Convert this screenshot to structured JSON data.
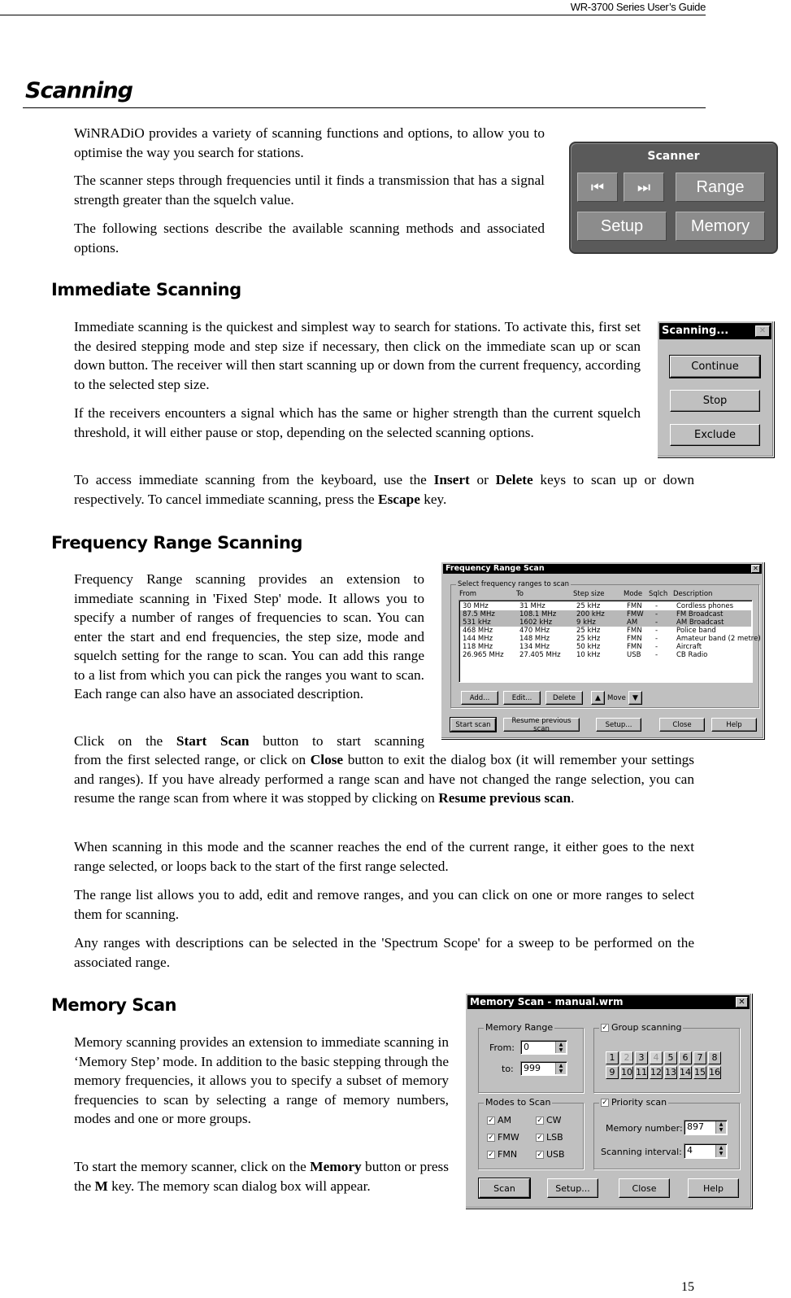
{
  "running_header": "WR-3700 Series User’s Guide",
  "page_title": "Scanning",
  "page_number": "15",
  "intro": [
    "WiNRADiO provides a variety of scanning functions and options, to allow you to optimise the way you search for stations.",
    "The scanner steps through frequencies until it finds a transmission that has a signal strength greater than the squelch value.",
    "The following sections describe the available scanning methods and associated options."
  ],
  "scanner_panel": {
    "title": "Scanner",
    "prev_icon": "skip-back-icon",
    "next_icon": "skip-forward-icon",
    "buttons": {
      "range": "Range",
      "setup": "Setup",
      "memory": "Memory"
    },
    "glyph_prev": "⏮",
    "glyph_next": "⏭"
  },
  "immediate": {
    "heading": "Immediate Scanning",
    "p1": "Immediate scanning is the quickest and simplest way to search for stations. To activate this, first set the desired stepping mode and step size if necessary, then click on the immediate scan up or scan down button. The receiver will then start scanning up or down from the current frequency, according to the selected step size.",
    "p2": "If the receivers encounters a signal which has the same or higher strength than the current squelch threshold, it will either pause or stop, depending on the selected scanning options.",
    "p3_a": "To access immediate scanning from the keyboard, use the ",
    "p3_b": "Insert",
    "p3_c": " or ",
    "p3_d": "Delete",
    "p3_e": " keys to scan up or down respectively. To cancel immediate scanning, press the ",
    "p3_f": "Escape",
    "p3_g": " key.",
    "dialog": {
      "title": "Scanning...",
      "buttons": [
        "Continue",
        "Stop",
        "Exclude"
      ],
      "mnemonics": [
        "C",
        "S",
        "E"
      ]
    }
  },
  "freq_range": {
    "heading": "Frequency Range Scanning",
    "p1": "Frequency Range scanning provides an extension to immediate scanning in  'Fixed Step' mode. It allows you to specify a number of ranges of frequencies to scan. You can enter the start and end frequencies, the step size, mode and squelch setting for the range to scan. You can add this range to a list from which you can pick the ranges you want to scan. Each range can also have an associated description.",
    "p2_a": "Click on the ",
    "p2_b": "Start Scan",
    "p2_c": " button to start scanning from the first selected range, or click on ",
    "p2_d": "Close",
    "p2_e": " button to exit the dialog box (it will remember your settings and ranges). If you have already performed a range scan and have not changed the range selection, you can resume the range scan from where it was stopped by clicking on ",
    "p2_f": "Resume previous scan",
    "p2_g": ".",
    "p3": "When scanning in this mode and the scanner reaches the end of the current range, it either goes to the next range selected, or loops back to the start of the first range selected.",
    "p4": "The range list allows you to add, edit and remove ranges, and you can click on one or more ranges to select them for scanning.",
    "p5": "Any ranges with descriptions can be selected in the 'Spectrum Scope' for a sweep to be performed on the associated range.",
    "dialog": {
      "title": "Frequency Range Scan",
      "group_label": "Select frequency ranges to scan",
      "columns": [
        "From",
        "To",
        "Step size",
        "Mode",
        "Sqlch",
        "Description"
      ],
      "rows": [
        {
          "from": "30 MHz",
          "to": "31 MHz",
          "step": "25 kHz",
          "mode": "FMN",
          "sqlch": "-",
          "desc": "Cordless phones",
          "selected": false
        },
        {
          "from": "87.5 MHz",
          "to": "108.1 MHz",
          "step": "200 kHz",
          "mode": "FMW",
          "sqlch": "-",
          "desc": "FM Broadcast",
          "selected": true
        },
        {
          "from": "531 kHz",
          "to": "1602 kHz",
          "step": "9 kHz",
          "mode": "AM",
          "sqlch": "-",
          "desc": "AM Broadcast",
          "selected": true
        },
        {
          "from": "468 MHz",
          "to": "470 MHz",
          "step": "25 kHz",
          "mode": "FMN",
          "sqlch": "-",
          "desc": "Police band",
          "selected": false
        },
        {
          "from": "144 MHz",
          "to": "148 MHz",
          "step": "25 kHz",
          "mode": "FMN",
          "sqlch": "-",
          "desc": "Amateur band (2 metre)",
          "selected": false
        },
        {
          "from": "118 MHz",
          "to": "134 MHz",
          "step": "50 kHz",
          "mode": "FMN",
          "sqlch": "-",
          "desc": "Aircraft",
          "selected": false
        },
        {
          "from": "26.965 MHz",
          "to": "27.405 MHz",
          "step": "10 kHz",
          "mode": "USB",
          "sqlch": "-",
          "desc": "CB Radio",
          "selected": false
        }
      ],
      "list_buttons": {
        "add": "Add...",
        "edit": "Edit...",
        "delete": "Delete",
        "move": "Move"
      },
      "bottom_buttons": {
        "start": "Start scan",
        "resume": "Resume previous scan",
        "setup": "Setup...",
        "close": "Close",
        "help": "Help"
      }
    }
  },
  "memory": {
    "heading": "Memory Scan",
    "p1": "Memory scanning provides an extension to immediate scanning in ‘Memory Step’ mode. In addition to the basic stepping through the memory frequencies, it allows you to specify a subset of memory frequencies to scan by selecting a range of memory numbers, modes and one or more groups.",
    "p2_a": "To start the memory scanner, click on the ",
    "p2_b": "Memory",
    "p2_c": " button or press the ",
    "p2_d": "M",
    "p2_e": " key. The memory scan dialog box will appear.",
    "dialog": {
      "title": "Memory Scan - manual.wrm",
      "memory_range": {
        "label": "Memory Range",
        "from_label": "From:",
        "from_value": "0",
        "to_label": "to:",
        "to_value": "999"
      },
      "group_scanning": {
        "label": "Group scanning",
        "checked": true,
        "groups": [
          "1",
          "2",
          "3",
          "4",
          "5",
          "6",
          "7",
          "8",
          "9",
          "10",
          "11",
          "12",
          "13",
          "14",
          "15",
          "16"
        ],
        "disabled_groups": [
          "2",
          "4"
        ]
      },
      "modes": {
        "label": "Modes to Scan",
        "items": [
          {
            "label": "AM",
            "checked": true
          },
          {
            "label": "CW",
            "checked": true
          },
          {
            "label": "FMW",
            "checked": true
          },
          {
            "label": "LSB",
            "checked": true
          },
          {
            "label": "FMN",
            "checked": true
          },
          {
            "label": "USB",
            "checked": true
          }
        ]
      },
      "priority": {
        "label": "Priority scan",
        "checked": true,
        "memory_number_label": "Memory number:",
        "memory_number": "897",
        "interval_label": "Scanning interval:",
        "interval": "4"
      },
      "buttons": {
        "scan": "Scan",
        "setup": "Setup...",
        "close": "Close",
        "help": "Help"
      }
    }
  }
}
